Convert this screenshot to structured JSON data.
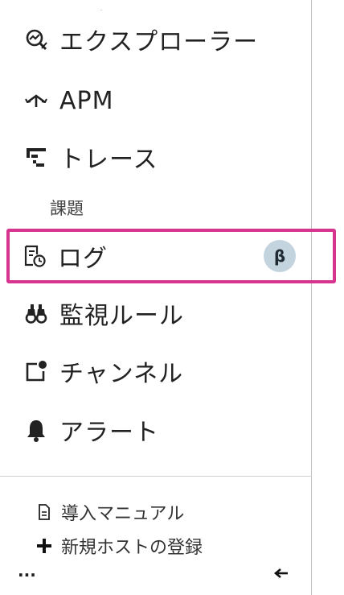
{
  "nav": {
    "explorer": {
      "label": "エクスプローラー",
      "icon": "explorer-icon"
    },
    "apm": {
      "label": "APM",
      "icon": "apm-arrows-icon"
    },
    "traces": {
      "label": "トレース",
      "icon": "traces-icon"
    },
    "issues_header": "課題",
    "logs": {
      "label": "ログ",
      "icon": "logs-icon",
      "badge": "β",
      "selected": true
    },
    "alert_rules": {
      "label": "監視ルール",
      "icon": "binoculars-icon"
    },
    "channels": {
      "label": "チャンネル",
      "icon": "channel-icon"
    },
    "alerts": {
      "label": "アラート",
      "icon": "bell-icon"
    }
  },
  "footer": {
    "manual": {
      "label": "導入マニュアル",
      "icon": "document-icon"
    },
    "register_host": {
      "label": "新規ホストの登録",
      "icon": "plus-icon"
    },
    "more": "···",
    "collapse_icon": "arrow-left-icon"
  },
  "colors": {
    "selected_border": "#d6348f",
    "badge_bg": "#c3d4df"
  }
}
